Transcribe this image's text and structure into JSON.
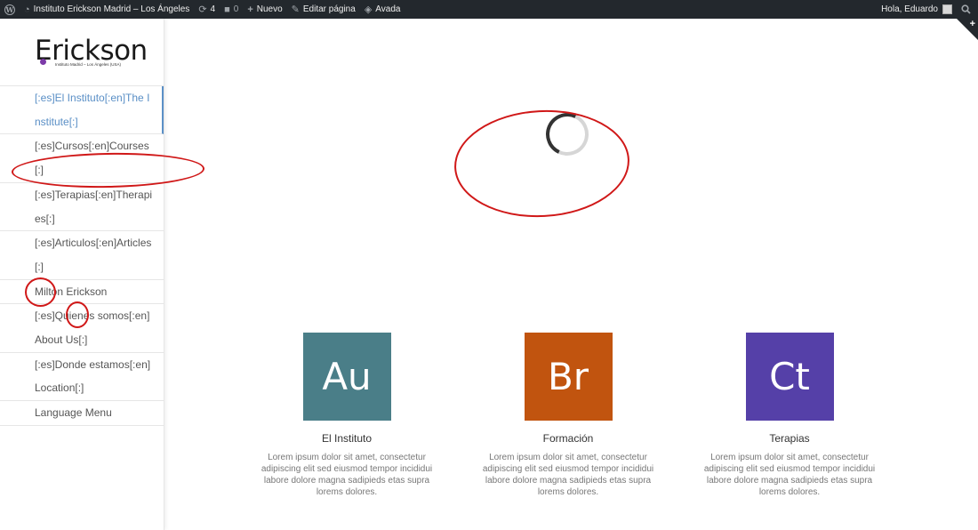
{
  "admin_bar": {
    "site_name": "Instituto Erickson Madrid – Los Ángeles",
    "updates_count": "4",
    "comments_count": "0",
    "new_label": "Nuevo",
    "edit_label": "Editar página",
    "avada_label": "Avada",
    "greeting": "Hola, Eduardo"
  },
  "logo": {
    "title": "Erickson",
    "subtitle": "Instituto Madrid – Los Ángeles (USA)"
  },
  "sidebar": {
    "items": [
      {
        "label": "[:es]El Instituto[:en]The Institute[:]",
        "active": true
      },
      {
        "label": "[:es]Cursos[:en]Courses[:]"
      },
      {
        "label": "[:es]Terapias[:en]Therapies[:]"
      },
      {
        "label": "[:es]Articulos[:en]Articles [:]"
      },
      {
        "label": "Milton Erickson"
      },
      {
        "label": "[:es]Quienes somos[:en]About Us[:]"
      },
      {
        "label": "[:es]Donde estamos[:en]Location[:]"
      },
      {
        "label": "Language Menu"
      }
    ]
  },
  "cards": [
    {
      "abbr": "Au",
      "title": "El Instituto",
      "color": "#4a7e88",
      "text": "Lorem ipsum dolor sit amet, consectetur adipiscing elit sed eiusmod tempor incididui labore dolore magna sadipieds etas supra lorems dolores."
    },
    {
      "abbr": "Br",
      "title": "Formación",
      "color": "#c1540f",
      "text": "Lorem ipsum dolor sit amet, consectetur adipiscing elit sed eiusmod tempor incididui labore dolore magna sadipieds etas supra lorems dolores."
    },
    {
      "abbr": "Ct",
      "title": "Terapias",
      "color": "#5540a8",
      "text": "Lorem ipsum dolor sit amet, consectetur adipiscing elit sed eiusmod tempor incididui labore dolore magna sadipieds etas supra lorems dolores."
    }
  ],
  "colors": {
    "admin_bar_bg": "#23282d",
    "active_link": "#5a8fc6",
    "annotation_red": "#d01818"
  }
}
